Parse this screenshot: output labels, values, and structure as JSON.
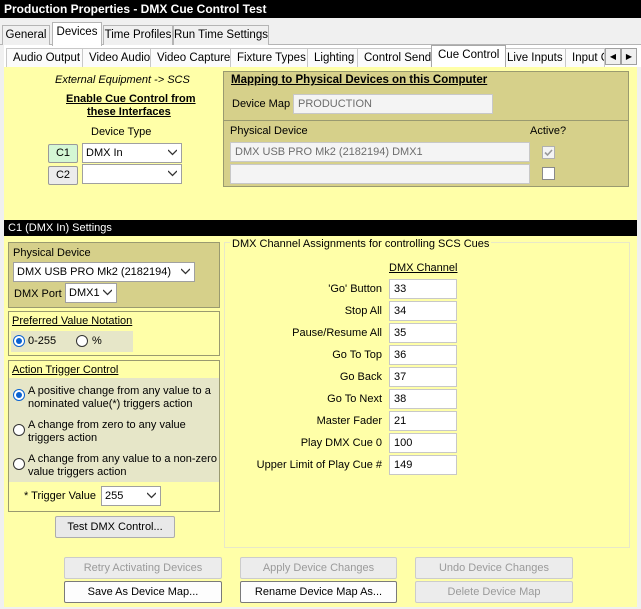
{
  "window": {
    "title": "Production Properties - DMX Cue Control Test"
  },
  "tabs_top": [
    {
      "label": "General"
    },
    {
      "label": "Devices"
    },
    {
      "label": "Time Profiles"
    },
    {
      "label": "Run Time Settings"
    }
  ],
  "tabs_devices": [
    {
      "label": "Audio Output"
    },
    {
      "label": "Video Audio"
    },
    {
      "label": "Video Capture"
    },
    {
      "label": "Fixture Types"
    },
    {
      "label": "Lighting"
    },
    {
      "label": "Control Send"
    },
    {
      "label": "Cue Control"
    },
    {
      "label": "Live Inputs"
    },
    {
      "label": "Input G"
    }
  ],
  "left_header": {
    "external": "External Equipment -> SCS",
    "enable_line1": "Enable Cue Control from",
    "enable_line2": "these Interfaces",
    "device_type_label": "Device Type"
  },
  "interfaces": [
    {
      "code": "C1",
      "device_type": "DMX In"
    },
    {
      "code": "C2",
      "device_type": ""
    }
  ],
  "mapping": {
    "title": "Mapping to Physical Devices on this Computer",
    "device_map_label": "Device Map",
    "device_map_value": "PRODUCTION",
    "physical_device_label": "Physical Device",
    "active_label": "Active?",
    "rows": [
      {
        "device": "DMX USB PRO Mk2 (2182194) DMX1",
        "active": true
      },
      {
        "device": "",
        "active": false
      }
    ]
  },
  "settings_bar": "C1 (DMX In) Settings",
  "physical": {
    "label": "Physical Device",
    "device": "DMX USB PRO Mk2 (2182194)",
    "port_label": "DMX Port",
    "port": "DMX1"
  },
  "notation": {
    "title": "Preferred Value Notation",
    "option1": "0-255",
    "option2": "%",
    "selected": "0-255"
  },
  "trigger": {
    "title": "Action Trigger Control",
    "options": [
      {
        "line1": "A positive change from any value to a",
        "line2": "nominated value(*) triggers action",
        "selected": true
      },
      {
        "line1": "A change from zero to any value",
        "line2": "triggers action",
        "selected": false
      },
      {
        "line1": "A change from any value to a non-zero",
        "line2": "value triggers action",
        "selected": false
      }
    ],
    "value_label": "* Trigger Value",
    "value": "255"
  },
  "test_button": "Test DMX Control...",
  "dmx_assign": {
    "title": "DMX Channel Assignments for controlling SCS Cues",
    "column_header": "DMX Channel",
    "rows": [
      {
        "label": "'Go' Button",
        "value": "33"
      },
      {
        "label": "Stop All",
        "value": "34"
      },
      {
        "label": "Pause/Resume All",
        "value": "35"
      },
      {
        "label": "Go To Top",
        "value": "36"
      },
      {
        "label": "Go Back",
        "value": "37"
      },
      {
        "label": "Go To Next",
        "value": "38"
      },
      {
        "label": "Master Fader",
        "value": "21"
      },
      {
        "label": "Play DMX Cue 0",
        "value": "100"
      },
      {
        "label": "Upper Limit of Play Cue #",
        "value": "149"
      }
    ]
  },
  "bottom_buttons": {
    "retry": "Retry Activating Devices",
    "apply": "Apply Device Changes",
    "undo": "Undo Device Changes",
    "save_map": "Save As Device Map...",
    "rename_map": "Rename Device Map As...",
    "delete_map": "Delete Device Map"
  },
  "colors": {
    "panel_yellow": "#ffffa8",
    "olive": "#d6d08a",
    "title_bar": "#000000",
    "selected_code": "#d4f7d4"
  }
}
